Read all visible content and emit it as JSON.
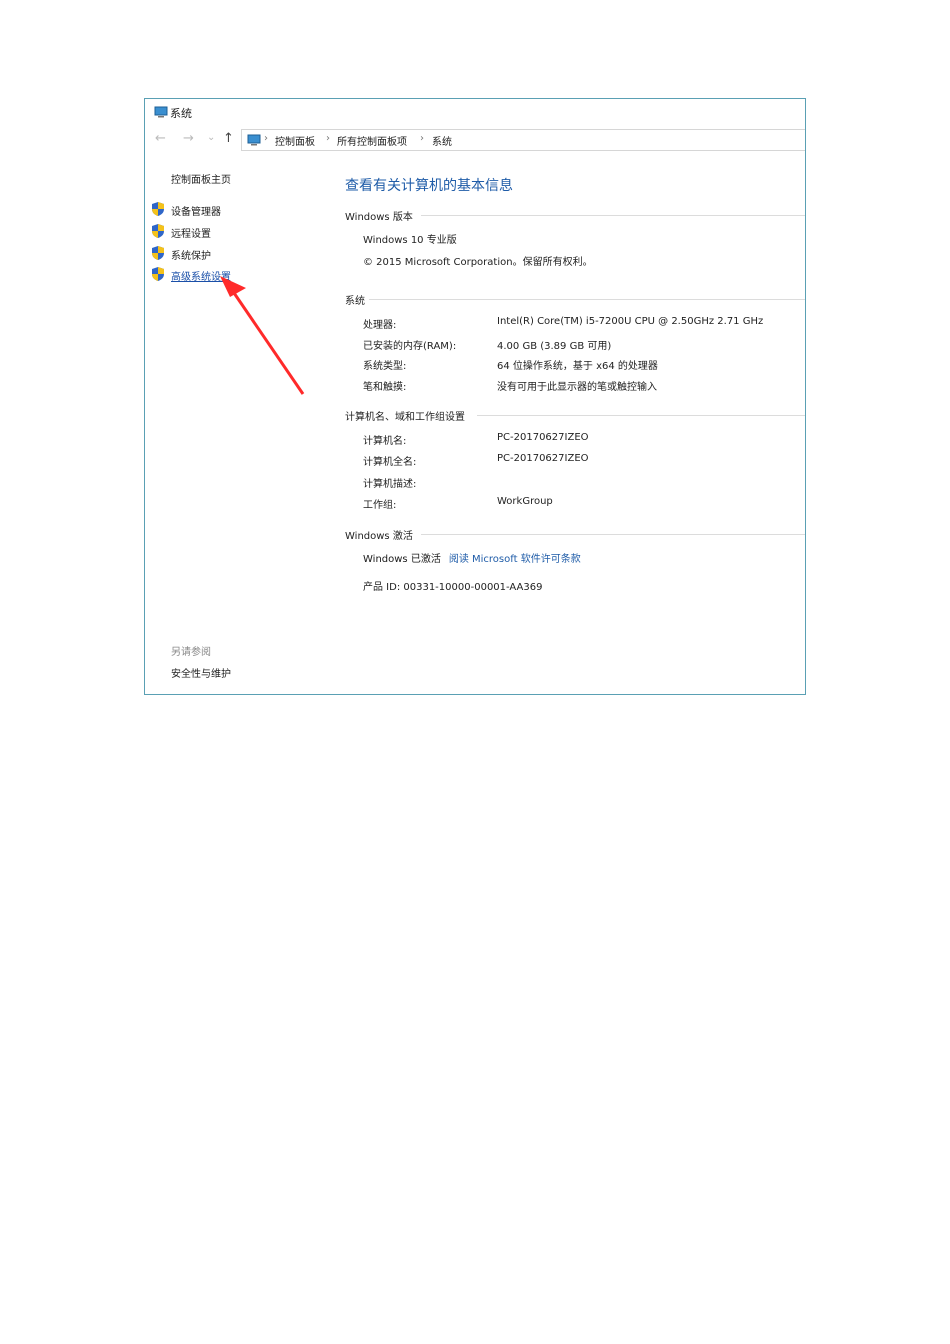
{
  "window": {
    "title": "系统"
  },
  "nav": {
    "back": "←",
    "forward": "→",
    "recent": "⌄",
    "up": "↑",
    "breadcrumb": [
      "控制面板",
      "所有控制面板项",
      "系统"
    ],
    "separator": "›"
  },
  "sidebar": {
    "home": "控制面板主页",
    "items": [
      {
        "label": "设备管理器"
      },
      {
        "label": "远程设置"
      },
      {
        "label": "系统保护"
      },
      {
        "label": "高级系统设置"
      }
    ],
    "see_also": "另请参阅",
    "see_also_link": "安全性与维护"
  },
  "main": {
    "title": "查看有关计算机的基本信息",
    "edition": {
      "header": "Windows 版本",
      "name": "Windows 10 专业版",
      "copyright": "© 2015 Microsoft Corporation。保留所有权利。"
    },
    "system": {
      "header": "系统",
      "rows": [
        {
          "label": "处理器:",
          "value": "Intel(R) Core(TM) i5-7200U CPU @ 2.50GHz   2.71 GHz"
        },
        {
          "label": "已安装的内存(RAM):",
          "value": "4.00 GB (3.89 GB 可用)"
        },
        {
          "label": "系统类型:",
          "value": "64 位操作系统，基于 x64 的处理器"
        },
        {
          "label": "笔和触摸:",
          "value": "没有可用于此显示器的笔或触控输入"
        }
      ]
    },
    "computer": {
      "header": "计算机名、域和工作组设置",
      "rows": [
        {
          "label": "计算机名:",
          "value": "PC-20170627IZEO"
        },
        {
          "label": "计算机全名:",
          "value": "PC-20170627IZEO"
        },
        {
          "label": "计算机描述:",
          "value": ""
        },
        {
          "label": "工作组:",
          "value": "WorkGroup"
        }
      ]
    },
    "activation": {
      "header": "Windows 激活",
      "status": "Windows 已激活",
      "link": "阅读 Microsoft 软件许可条款",
      "product_id": "产品 ID: 00331-10000-00001-AA369"
    }
  },
  "colors": {
    "accent": "#1f5ca8",
    "border": "#5aa0b4",
    "arrow": "#ff2a2a"
  }
}
